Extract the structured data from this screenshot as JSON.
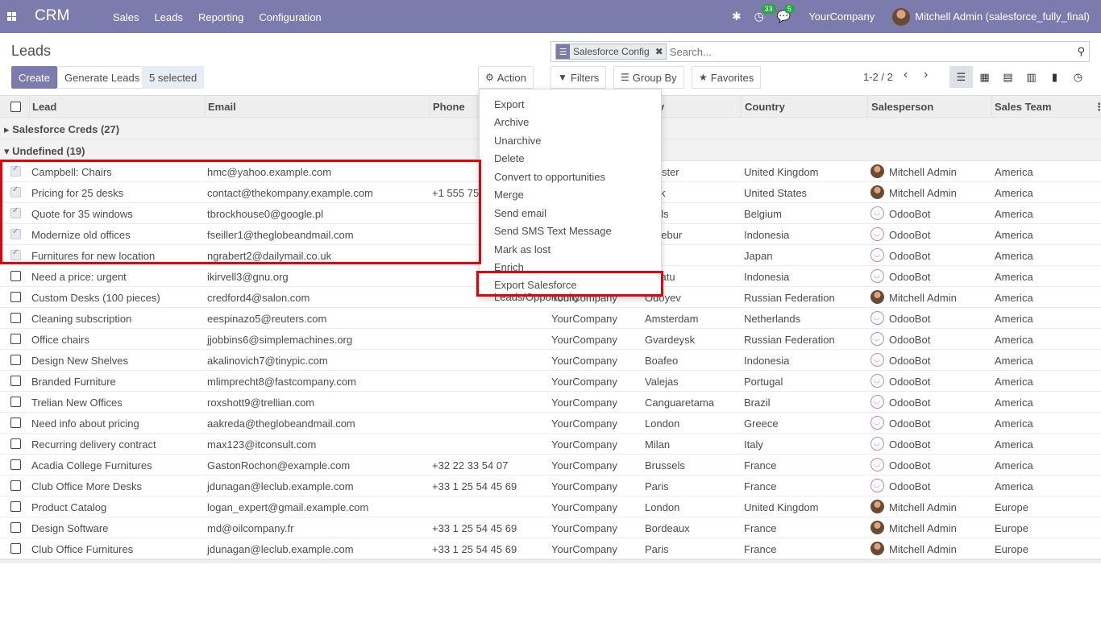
{
  "navbar": {
    "brand": "CRM",
    "menu": [
      "Sales",
      "Leads",
      "Reporting",
      "Configuration"
    ],
    "activity_count": "33",
    "message_count": "5",
    "company": "YourCompany",
    "user": "Mitchell Admin (salesforce_fully_final)"
  },
  "control": {
    "title": "Leads",
    "create_label": "Create",
    "generate_label": "Generate Leads",
    "selected_label": "5 selected",
    "action_label": "Action",
    "filters_label": "Filters",
    "groupby_label": "Group By",
    "favorites_label": "Favorites",
    "pager": "1-2 / 2"
  },
  "search": {
    "facet": "Salesforce Config",
    "placeholder": "Search..."
  },
  "columns": [
    "Lead",
    "Email",
    "Phone",
    "Country",
    "Salesperson",
    "Sales Team"
  ],
  "column_partial": "y",
  "groups": [
    {
      "label": "Salesforce Creds (27)",
      "open": false
    },
    {
      "label": "Undefined (19)",
      "open": true
    }
  ],
  "rows": [
    {
      "lead": "Campbell: Chairs",
      "email": "hmc@yahoo.example.com",
      "phone": "",
      "company": "",
      "city": "chester",
      "country": "United Kingdom",
      "salesperson": "Mitchell Admin",
      "team": "America",
      "checked": true,
      "avatar": "mitchell"
    },
    {
      "lead": "Pricing for 25 desks",
      "email": "contact@thekompany.example.com",
      "phone": "+1 555 754",
      "company": "",
      "city": "York",
      "country": "United States",
      "salesperson": "Mitchell Admin",
      "team": "America",
      "checked": true,
      "avatar": "mitchell"
    },
    {
      "lead": "Quote for 35 windows",
      "email": "tbrockhouse0@google.pl",
      "phone": "",
      "company": "",
      "city": "ssels",
      "country": "Belgium",
      "salesperson": "OdooBot",
      "team": "America",
      "checked": true,
      "avatar": "bot"
    },
    {
      "lead": "Modernize old offices",
      "email": "fseiller1@theglobeandmail.com",
      "phone": "",
      "company": "",
      "city": "igelebur",
      "country": "Indonesia",
      "salesperson": "OdooBot",
      "team": "America",
      "checked": true,
      "avatar": "bot"
    },
    {
      "lead": "Furnitures for new location",
      "email": "ngrabert2@dailymail.co.uk",
      "phone": "",
      "company": "",
      "city": "yo",
      "country": "Japan",
      "salesperson": "OdooBot",
      "team": "America",
      "checked": true,
      "avatar": "bot"
    },
    {
      "lead": "Need a price: urgent",
      "email": "ikirvell3@gnu.org",
      "phone": "",
      "company": "",
      "city": "u Satu",
      "country": "Indonesia",
      "salesperson": "OdooBot",
      "team": "America",
      "checked": false,
      "avatar": "bot"
    },
    {
      "lead": "Custom Desks (100 pieces)",
      "email": "credford4@salon.com",
      "phone": "",
      "company": "YourCompany",
      "city": "Odoyev",
      "country": "Russian Federation",
      "salesperson": "Mitchell Admin",
      "team": "America",
      "checked": false,
      "avatar": "mitchell"
    },
    {
      "lead": "Cleaning subscription",
      "email": "eespinazo5@reuters.com",
      "phone": "",
      "company": "YourCompany",
      "city": "Amsterdam",
      "country": "Netherlands",
      "salesperson": "OdooBot",
      "team": "America",
      "checked": false,
      "avatar": "bot"
    },
    {
      "lead": "Office chairs",
      "email": "jjobbins6@simplemachines.org",
      "phone": "",
      "company": "YourCompany",
      "city": "Gvardeysk",
      "country": "Russian Federation",
      "salesperson": "OdooBot",
      "team": "America",
      "checked": false,
      "avatar": "bot"
    },
    {
      "lead": "Design New Shelves",
      "email": "akalinovich7@tinypic.com",
      "phone": "",
      "company": "YourCompany",
      "city": "Boafeo",
      "country": "Indonesia",
      "salesperson": "OdooBot",
      "team": "America",
      "checked": false,
      "avatar": "bot"
    },
    {
      "lead": "Branded Furniture",
      "email": "mlimprecht8@fastcompany.com",
      "phone": "",
      "company": "YourCompany",
      "city": "Valejas",
      "country": "Portugal",
      "salesperson": "OdooBot",
      "team": "America",
      "checked": false,
      "avatar": "bot"
    },
    {
      "lead": "Trelian New Offices",
      "email": "roxshott9@trellian.com",
      "phone": "",
      "company": "YourCompany",
      "city": "Canguaretama",
      "country": "Brazil",
      "salesperson": "OdooBot",
      "team": "America",
      "checked": false,
      "avatar": "bot"
    },
    {
      "lead": "Need info about pricing",
      "email": "aakreda@theglobeandmail.com",
      "phone": "",
      "company": "YourCompany",
      "city": "London",
      "country": "Greece",
      "salesperson": "OdooBot",
      "team": "America",
      "checked": false,
      "avatar": "bot"
    },
    {
      "lead": "Recurring delivery contract",
      "email": "max123@itconsult.com",
      "phone": "",
      "company": "YourCompany",
      "city": "Milan",
      "country": "Italy",
      "salesperson": "OdooBot",
      "team": "America",
      "checked": false,
      "avatar": "bot"
    },
    {
      "lead": "Acadia College Furnitures",
      "email": "GastonRochon@example.com",
      "phone": "+32 22 33 54 07",
      "company": "YourCompany",
      "city": "Brussels",
      "country": "France",
      "salesperson": "OdooBot",
      "team": "America",
      "checked": false,
      "avatar": "bot"
    },
    {
      "lead": "Club Office More Desks",
      "email": "jdunagan@leclub.example.com",
      "phone": "+33 1 25 54 45 69",
      "company": "YourCompany",
      "city": "Paris",
      "country": "France",
      "salesperson": "OdooBot",
      "team": "America",
      "checked": false,
      "avatar": "bot"
    },
    {
      "lead": "Product Catalog",
      "email": "logan_expert@gmail.example.com",
      "phone": "",
      "company": "YourCompany",
      "city": "London",
      "country": "United Kingdom",
      "salesperson": "Mitchell Admin",
      "team": "Europe",
      "checked": false,
      "avatar": "mitchell"
    },
    {
      "lead": "Design Software",
      "email": "md@oilcompany.fr",
      "phone": "+33 1 25 54 45 69",
      "company": "YourCompany",
      "city": "Bordeaux",
      "country": "France",
      "salesperson": "Mitchell Admin",
      "team": "Europe",
      "checked": false,
      "avatar": "mitchell"
    },
    {
      "lead": "Club Office Furnitures",
      "email": "jdunagan@leclub.example.com",
      "phone": "+33 1 25 54 45 69",
      "company": "YourCompany",
      "city": "Paris",
      "country": "France",
      "salesperson": "Mitchell Admin",
      "team": "Europe",
      "checked": false,
      "avatar": "mitchell"
    }
  ],
  "action_menu": [
    "Export",
    "Archive",
    "Unarchive",
    "Delete",
    "Convert to opportunities",
    "Merge",
    "Send email",
    "Send SMS Text Message",
    "Mark as lost",
    "Enrich",
    "Export Salesforce Leads/Opportunity"
  ],
  "colors": {
    "brand": "#7c7bad",
    "highlight": "#e8000b",
    "badge": "#28a745"
  }
}
